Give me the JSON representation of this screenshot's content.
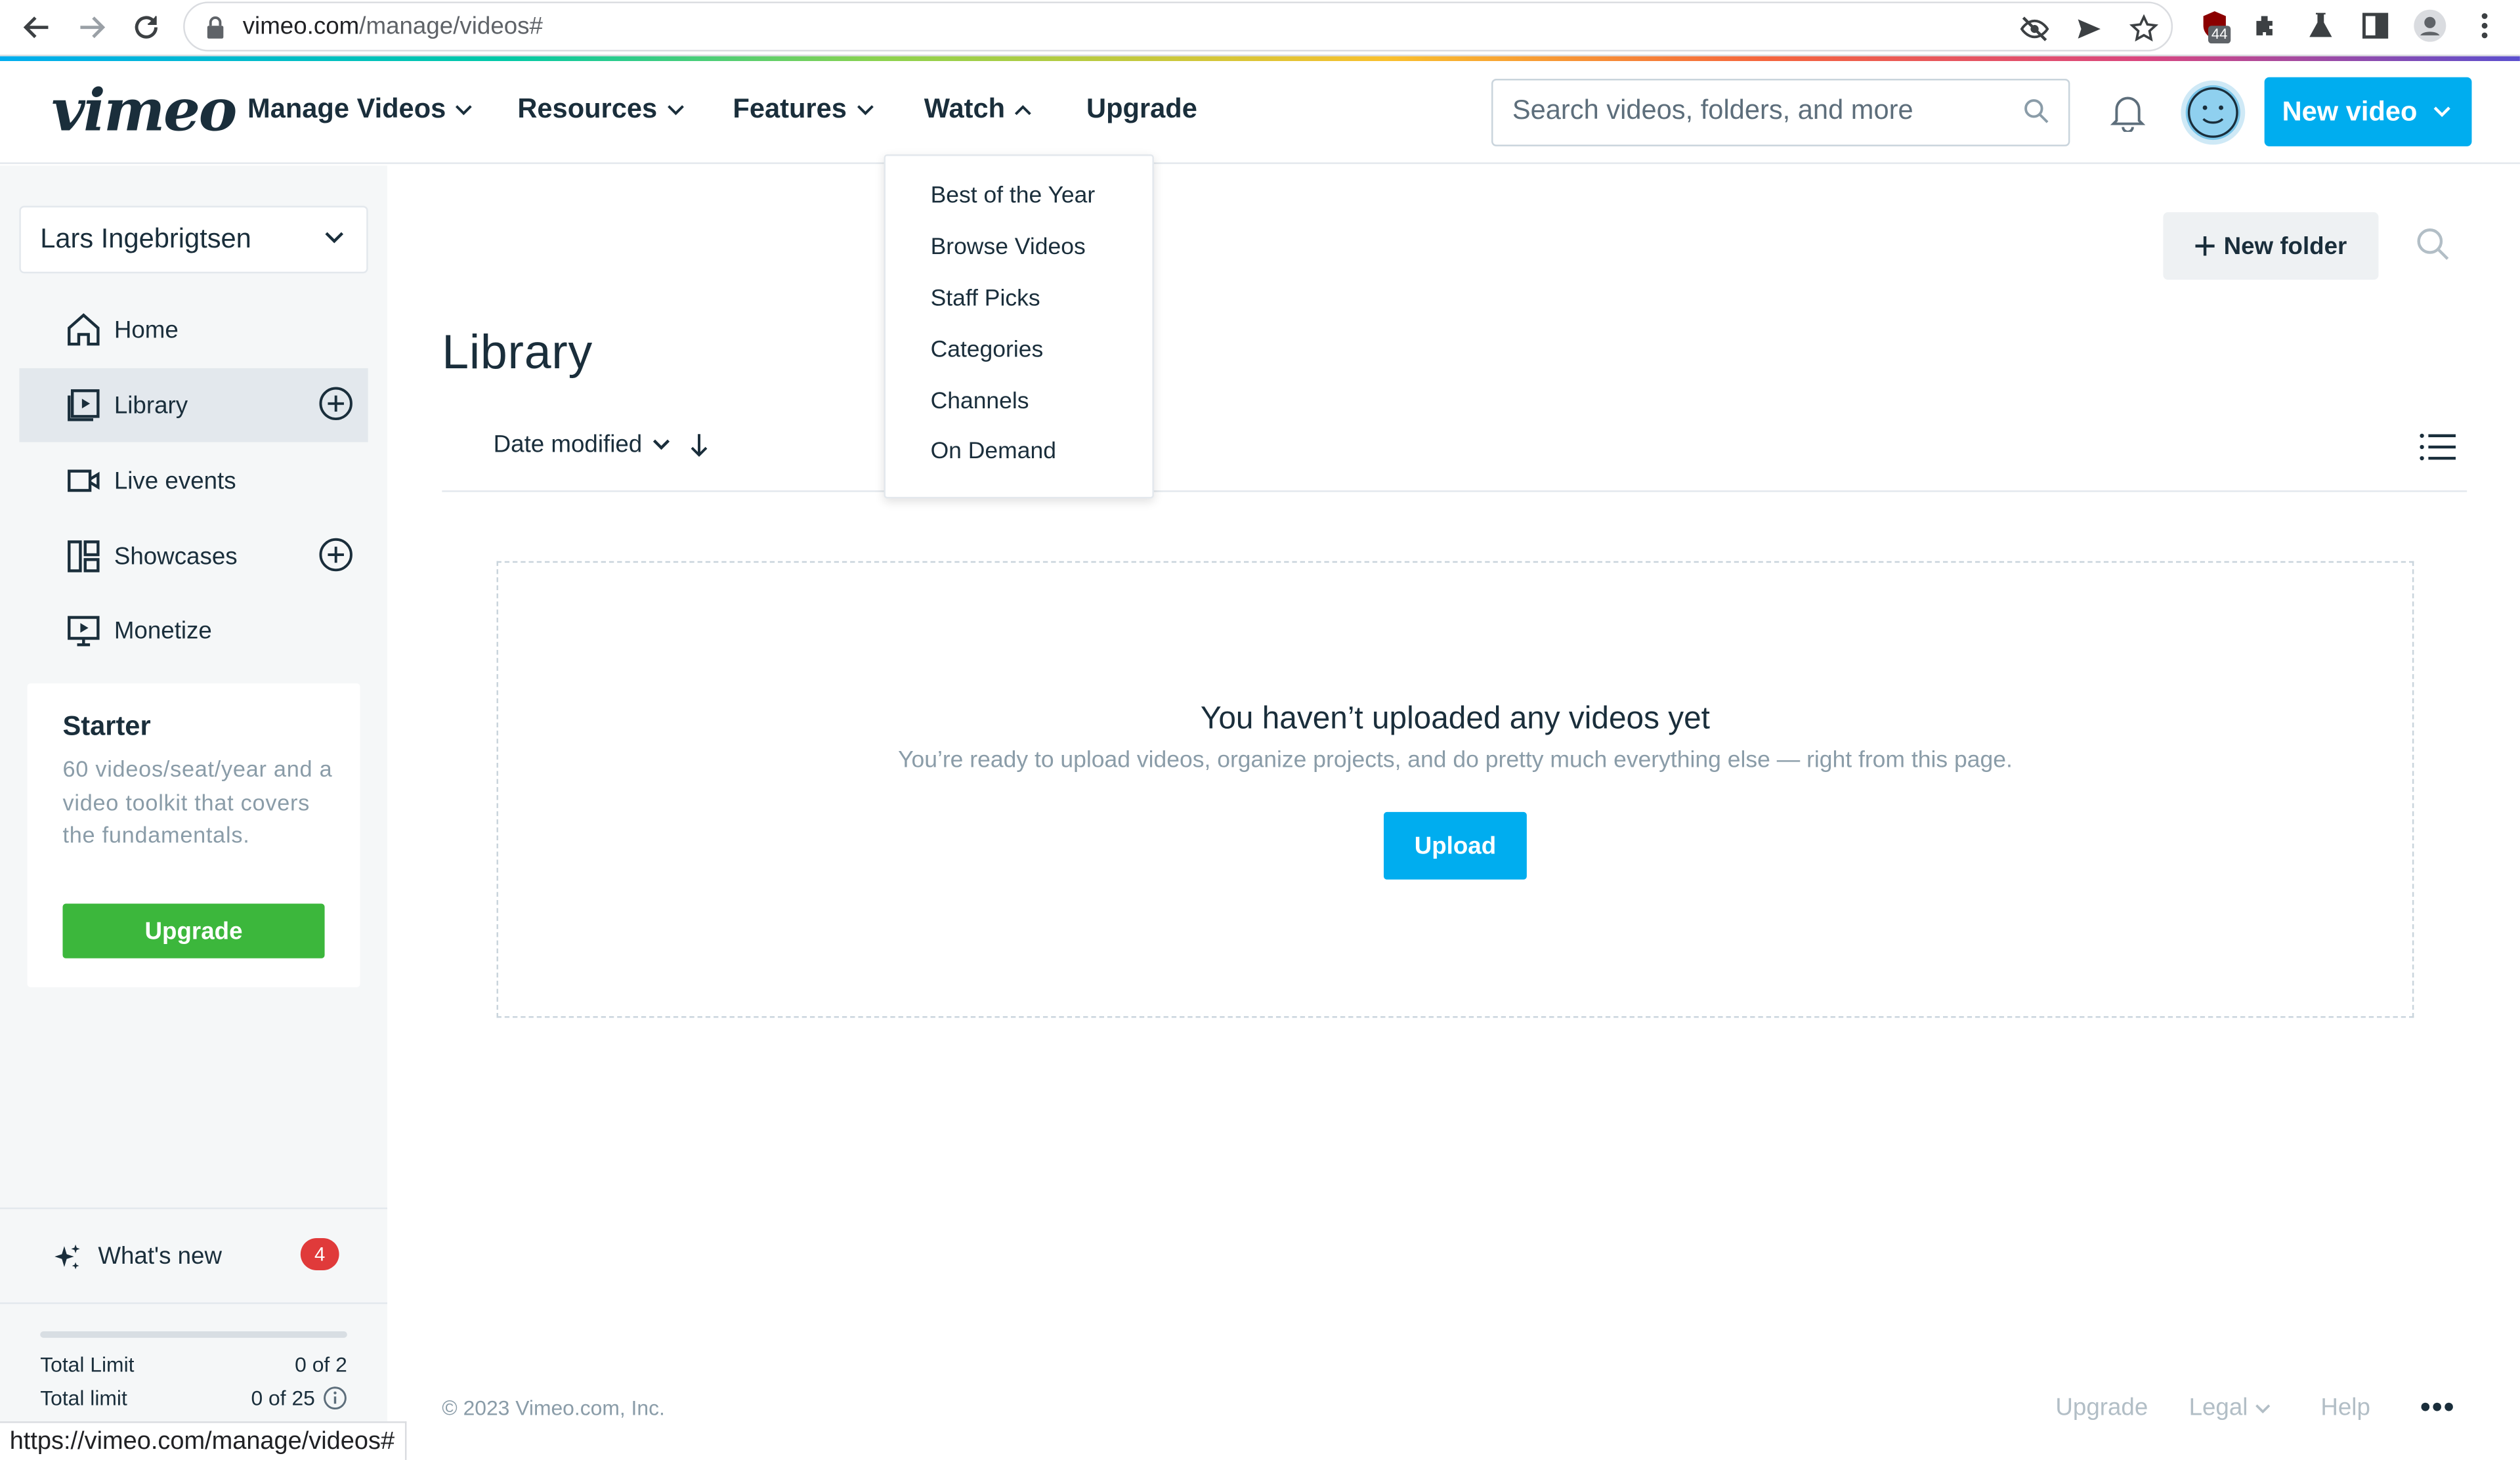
{
  "browser": {
    "url_host": "vimeo.com",
    "url_path": "/manage/videos#",
    "extension_badge": "44"
  },
  "header": {
    "logo": "vimeo",
    "nav": [
      {
        "label": "Manage Videos",
        "chevron": "down"
      },
      {
        "label": "Resources",
        "chevron": "down"
      },
      {
        "label": "Features",
        "chevron": "down"
      },
      {
        "label": "Watch",
        "chevron": "up"
      },
      {
        "label": "Upgrade"
      }
    ],
    "search_placeholder": "Search videos, folders, and more",
    "new_video_label": "New video"
  },
  "watch_menu": {
    "items": [
      "Best of the Year",
      "Browse Videos",
      "Staff Picks",
      "Categories",
      "Channels",
      "On Demand"
    ]
  },
  "sidebar": {
    "team_name": "Lars Ingebrigtsen",
    "items": [
      {
        "label": "Home",
        "icon": "home-icon"
      },
      {
        "label": "Library",
        "icon": "library-icon",
        "active": true
      },
      {
        "label": "Live events",
        "icon": "camera-icon"
      },
      {
        "label": "Showcases",
        "icon": "showcase-icon"
      },
      {
        "label": "Monetize",
        "icon": "monetize-icon"
      }
    ],
    "starter": {
      "title": "Starter",
      "description": "60 videos/seat/year and a video toolkit that covers the fundamentals.",
      "button": "Upgrade"
    },
    "whats_new": {
      "label": "What's new",
      "count": "4"
    },
    "limits": [
      {
        "label": "Total Limit",
        "value": "0 of 2"
      },
      {
        "label": "Total limit",
        "value": "0 of 25"
      }
    ],
    "limit_fraction": 0
  },
  "main": {
    "new_folder_label": "New folder",
    "title": "Library",
    "sort_label": "Date modified",
    "empty": {
      "heading": "You haven’t uploaded any videos yet",
      "text": "You’re ready to upload videos, organize projects, and do pretty much everything else — right from this page.",
      "button": "Upload"
    },
    "footer": {
      "copyright": "© 2023 Vimeo.com, Inc.",
      "links": [
        "Upgrade",
        "Legal",
        "Help"
      ],
      "more": "•••"
    }
  },
  "status_url": "https://vimeo.com/manage/videos#",
  "colors": {
    "accent": "#00adef",
    "upgrade_green": "#3cb73c",
    "badge_red": "#e03a3a",
    "text": "#1a2e3b"
  }
}
